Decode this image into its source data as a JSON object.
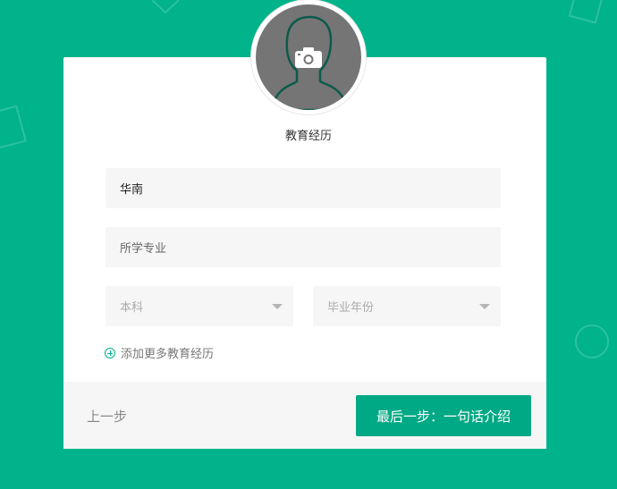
{
  "section_title": "教育经历",
  "form": {
    "school_value": "华南",
    "major_placeholder": "所学专业",
    "degree_selected": "本科",
    "year_placeholder": "毕业年份"
  },
  "add_more_label": "添加更多教育经历",
  "footer": {
    "prev_label": "上一步",
    "next_label": "最后一步：一句话介绍"
  },
  "icons": {
    "avatar": "person-silhouette-icon",
    "camera": "camera-icon",
    "add": "plus-circle-icon",
    "caret": "chevron-down-icon"
  },
  "colors": {
    "background": "#00b38a",
    "primary_button": "#00a985",
    "field_bg": "#f6f6f6"
  }
}
